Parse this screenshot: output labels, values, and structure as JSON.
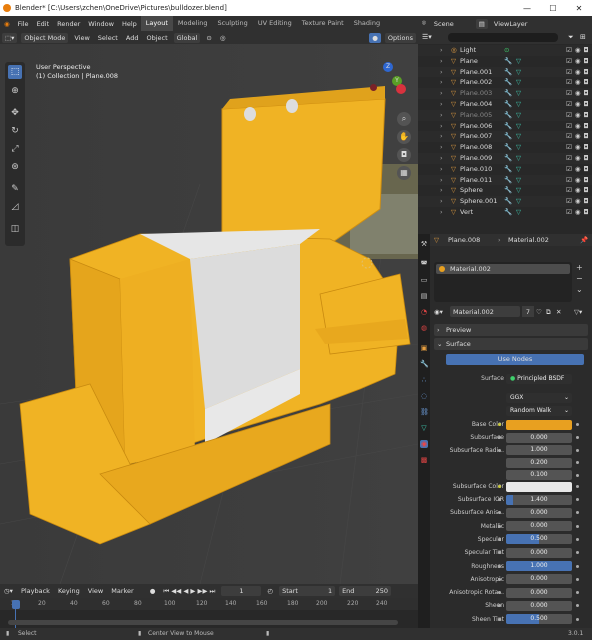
{
  "window": {
    "title": "Blender* [C:\\Users\\zchen\\OneDrive\\Pictures\\bulldozer.blend]",
    "minimize": "—",
    "maximize": "☐",
    "close": "✕"
  },
  "menu": {
    "file": "File",
    "edit": "Edit",
    "render": "Render",
    "window": "Window",
    "help": "Help"
  },
  "workspaces": [
    "Layout",
    "Modeling",
    "Sculpting",
    "UV Editing",
    "Texture Paint",
    "Shading"
  ],
  "scene": {
    "name": "Scene",
    "view_layer": "ViewLayer"
  },
  "viewport_header": {
    "mode": "Object Mode",
    "view": "View",
    "select": "Select",
    "add": "Add",
    "object": "Object",
    "orientation": "Global",
    "options": "Options"
  },
  "viewport": {
    "perspective": "User Perspective",
    "collection": "(1) Collection | Plane.008",
    "axis_z": "Z",
    "axis_y": "Y"
  },
  "outliner": {
    "rows": [
      {
        "name": "Light",
        "type": "light",
        "dim": false
      },
      {
        "name": "Plane",
        "type": "mesh",
        "dim": false
      },
      {
        "name": "Plane.001",
        "type": "mesh",
        "dim": false
      },
      {
        "name": "Plane.002",
        "type": "mesh",
        "dim": false
      },
      {
        "name": "Plane.003",
        "type": "mesh",
        "dim": true
      },
      {
        "name": "Plane.004",
        "type": "mesh",
        "dim": false
      },
      {
        "name": "Plane.005",
        "type": "mesh",
        "dim": true
      },
      {
        "name": "Plane.006",
        "type": "mesh",
        "dim": false
      },
      {
        "name": "Plane.007",
        "type": "mesh",
        "dim": false
      },
      {
        "name": "Plane.008",
        "type": "mesh",
        "dim": false
      },
      {
        "name": "Plane.009",
        "type": "mesh",
        "dim": false
      },
      {
        "name": "Plane.010",
        "type": "mesh",
        "dim": false
      },
      {
        "name": "Plane.011",
        "type": "mesh",
        "dim": false
      },
      {
        "name": "Sphere",
        "type": "mesh",
        "dim": false
      },
      {
        "name": "Sphere.001",
        "type": "mesh",
        "dim": false
      },
      {
        "name": "Vert",
        "type": "mesh",
        "dim": false
      }
    ]
  },
  "properties": {
    "breadcrumb_object": "Plane.008",
    "breadcrumb_material": "Material.002",
    "slot_material": "Material.002",
    "material_name": "Material.002",
    "users": "7",
    "preview": "Preview",
    "surface_section": "Surface",
    "use_nodes": "Use Nodes",
    "surface_label": "Surface",
    "surface_value": "Principled BSDF",
    "distribution": "GGX",
    "subsurface_method": "Random Walk",
    "base_color_label": "Base Color",
    "base_color": "#e8a020",
    "subsurface_color": "#e8e8e8",
    "fields": [
      {
        "label": "Subsurface",
        "value": "0.000",
        "fill": 0
      },
      {
        "label": "Subsurface Radi...",
        "value": "1.000",
        "fill": 0
      },
      {
        "label": "",
        "value": "0.200",
        "fill": 0
      },
      {
        "label": "",
        "value": "0.100",
        "fill": 0
      }
    ],
    "fields2": [
      {
        "label": "Subsurface IOR",
        "value": "1.400",
        "fill": 0.1
      },
      {
        "label": "Subsurface Anis...",
        "value": "0.000",
        "fill": 0
      },
      {
        "label": "Metallic",
        "value": "0.000",
        "fill": 0
      },
      {
        "label": "Specular",
        "value": "0.500",
        "fill": 0.5
      },
      {
        "label": "Specular Tint",
        "value": "0.000",
        "fill": 0
      },
      {
        "label": "Roughness",
        "value": "1.000",
        "fill": 1
      },
      {
        "label": "Anisotropic",
        "value": "0.000",
        "fill": 0
      },
      {
        "label": "Anisotropic Rota...",
        "value": "0.000",
        "fill": 0
      },
      {
        "label": "Sheen",
        "value": "0.000",
        "fill": 0
      },
      {
        "label": "Sheen Tint",
        "value": "0.500",
        "fill": 0.5
      }
    ],
    "subsurface_color_label": "Subsurface Color"
  },
  "timeline": {
    "playback": "Playback",
    "keying": "Keying",
    "view": "View",
    "marker": "Marker",
    "current": "1",
    "start_label": "Start",
    "start": "1",
    "end_label": "End",
    "end": "250",
    "ticks": [
      "1",
      "20",
      "40",
      "60",
      "80",
      "100",
      "120",
      "140",
      "160",
      "180",
      "200",
      "220",
      "240"
    ]
  },
  "status": {
    "select": "Select",
    "center": "Center View to Mouse",
    "version": "3.0.1"
  },
  "colors": {
    "accent": "#4772b3",
    "yellow": "#e8b21c",
    "active_tab": "#484848"
  }
}
